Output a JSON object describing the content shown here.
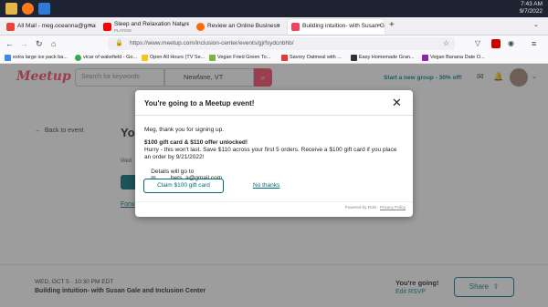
{
  "taskbar": {
    "time": "7:43 AM",
    "date": "9/7/2022"
  },
  "tabs": [
    {
      "title": "All Mail - meg.oceanna@gmail.c",
      "subtitle": ""
    },
    {
      "title": "Sleep and Relaxation Nature So",
      "subtitle": "PLAYING"
    },
    {
      "title": "Review an Online Business",
      "subtitle": ""
    },
    {
      "title": "Building intuition- with Susan G",
      "subtitle": ""
    }
  ],
  "new_tab_label": "+",
  "url": "https://www.meetup.com/inclusion-center/events/gjrfsydcnbhb/",
  "bookmarks": [
    "extra large ice pack ba...",
    "vicar of wakefield - Go...",
    "Open All Hours (TV Se...",
    "Vegan Fried Green To...",
    "Savory Oatmeal with ...",
    "Easy Homemade Gran...",
    "Vegan Banana Date O..."
  ],
  "meetup": {
    "logo": "Meetup",
    "search_placeholder": "Search for keywords",
    "location": "Newfane, VT",
    "promo": "Start a new group - 30% off!",
    "back_link": "Back to event",
    "heading_fragment": "Yo",
    "sub_fragment": "Wed",
    "forward_fragment": "Forw",
    "event_date": "WED, OCT 5 · 10:30 PM EDT",
    "event_title": "Building intuition- with Susan Gale and Inclusion Center",
    "going": "You're going!",
    "edit_rsvp": "Edit RSVP",
    "share": "Share"
  },
  "modal": {
    "title": "You're going to a Meetup event!",
    "greeting": "Meg, thank you for signing up.",
    "offer_heading": "$100 gift card & $110 offer unlocked!",
    "offer_body": "Hurry - this won't last. Save $110 across your first 5 orders. Receive a $100 gift card if you place an order by 9/21/2022!",
    "details_prefix": "Details will go to",
    "details_email": "m         bers  a@gmail.com",
    "claim_button": "Claim $100 gift card",
    "no_thanks": "No thanks",
    "powered_by": "Powered by",
    "rokt": "Rokt",
    "privacy": "Privacy Policy"
  },
  "colors": {
    "meetup_red": "#f64060",
    "claim_teal": "#00687a",
    "taskbar": "#1f2433"
  }
}
